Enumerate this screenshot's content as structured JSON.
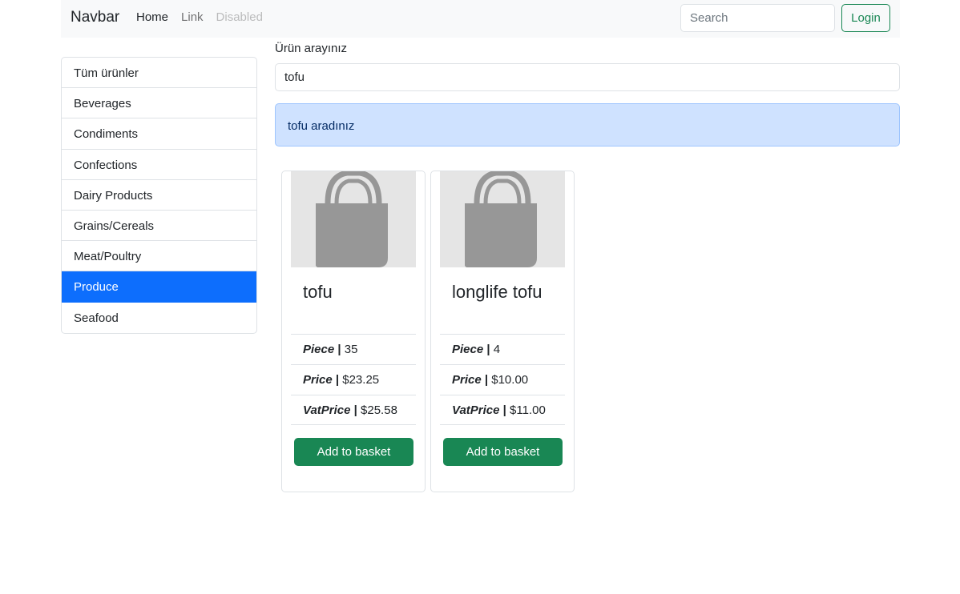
{
  "navbar": {
    "brand": "Navbar",
    "links": [
      {
        "label": "Home",
        "state": "active"
      },
      {
        "label": "Link",
        "state": "normal"
      },
      {
        "label": "Disabled",
        "state": "disabled"
      }
    ],
    "search_placeholder": "Search",
    "login_label": "Login"
  },
  "sidebar": {
    "items": [
      {
        "label": "Tüm ürünler"
      },
      {
        "label": "Beverages"
      },
      {
        "label": "Condiments"
      },
      {
        "label": "Confections"
      },
      {
        "label": "Dairy Products"
      },
      {
        "label": "Grains/Cereals"
      },
      {
        "label": "Meat/Poultry"
      },
      {
        "label": "Produce"
      },
      {
        "label": "Seafood"
      }
    ],
    "active_index": 7
  },
  "main": {
    "search_label": "Ürün arayınız",
    "search_value": "tofu",
    "alert_text": "tofu aradınız",
    "products": [
      {
        "icon": "shopping-bag-icon",
        "name": "tofu",
        "piece_label": "Piece",
        "piece": "35",
        "price_label": "Price",
        "price": "$23.25",
        "vat_label": "VatPrice",
        "vat_price": "$25.58",
        "button_label": "Add to basket"
      },
      {
        "icon": "shopping-bag-icon",
        "name": "longlife tofu",
        "piece_label": "Piece",
        "piece": "4",
        "price_label": "Price",
        "price": "$10.00",
        "vat_label": "VatPrice",
        "vat_price": "$11.00",
        "button_label": "Add to basket"
      }
    ]
  },
  "colors": {
    "primary": "#0d6efd",
    "success": "#198754",
    "alert_bg": "#cfe2ff",
    "navbar_bg": "#f8f9fa",
    "image_bg": "#e5e5e5",
    "bag_icon": "#979797"
  }
}
